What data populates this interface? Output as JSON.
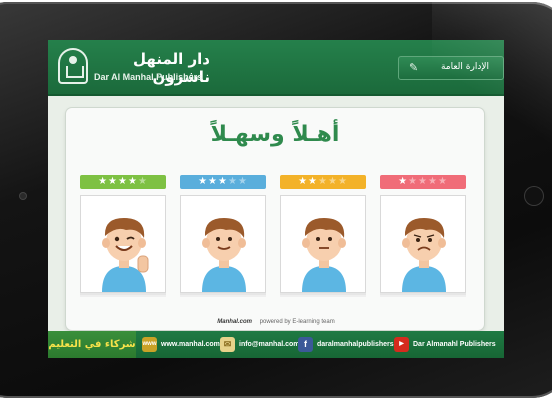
{
  "header": {
    "logo_arabic": "دار المنهل ناشرون",
    "logo_english": "Dar Al Manhal Publishers",
    "admin_button_label": "الإدارة العامة"
  },
  "main": {
    "title": "أهـلاً وسهـلاً",
    "cards": [
      {
        "rating": 4,
        "max": 5,
        "mood": "excellent",
        "color": "#7ec143"
      },
      {
        "rating": 3,
        "max": 5,
        "mood": "good",
        "color": "#5aaedc"
      },
      {
        "rating": 2,
        "max": 5,
        "mood": "average",
        "color": "#f3b229"
      },
      {
        "rating": 1,
        "max": 5,
        "mood": "poor",
        "color": "#f06c78"
      }
    ]
  },
  "powered": {
    "brand": "Manhal.com",
    "text": "powered by E-learning team"
  },
  "footer": {
    "partner_label": "شركاء في التعليم",
    "links": [
      {
        "icon": "www-icon",
        "text": "www.manhal.com"
      },
      {
        "icon": "mail-icon",
        "text": "info@manhal.com"
      },
      {
        "icon": "facebook-icon",
        "text": "daralmanhalpublishers"
      },
      {
        "icon": "youtube-icon",
        "text": "Dar Almanahl Publishers"
      }
    ]
  }
}
